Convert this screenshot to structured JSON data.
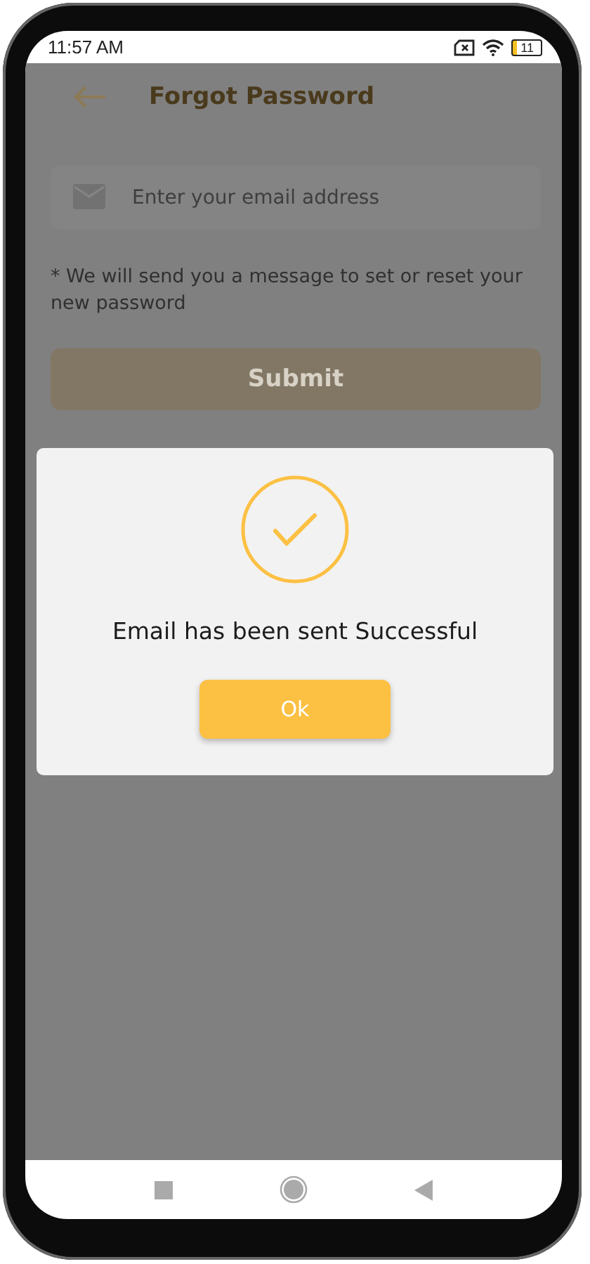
{
  "status_bar": {
    "time": "11:57 AM",
    "battery_text": "11"
  },
  "header": {
    "title": "Forgot Password"
  },
  "email_field": {
    "placeholder": "Enter your email address"
  },
  "note": "*  We will send you a message to set or reset your new password",
  "submit_button": "Submit",
  "dialog": {
    "message": "Email has been sent Successful",
    "ok_button": "Ok"
  }
}
